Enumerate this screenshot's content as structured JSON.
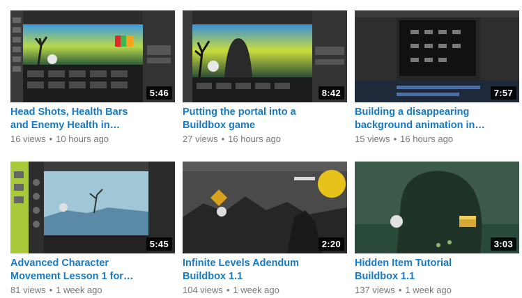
{
  "videos": [
    {
      "title_line1": "Head Shots, Health Bars",
      "title_line2": "and Enemy Health in…",
      "views": "16 views",
      "age": "10 hours ago",
      "duration": "5:46"
    },
    {
      "title_line1": "Putting the portal into a",
      "title_line2": "Buildbox game",
      "views": "27 views",
      "age": "16 hours ago",
      "duration": "8:42"
    },
    {
      "title_line1": "Building a disappearing",
      "title_line2": "background animation in…",
      "views": "15 views",
      "age": "16 hours ago",
      "duration": "7:57"
    },
    {
      "title_line1": "Advanced Character",
      "title_line2": "Movement Lesson 1 for…",
      "views": "81 views",
      "age": "1 week ago",
      "duration": "5:45"
    },
    {
      "title_line1": "Infinite Levels Adendum",
      "title_line2": "Buildbox 1.1",
      "views": "104 views",
      "age": "1 week ago",
      "duration": "2:20"
    },
    {
      "title_line1": "Hidden Item Tutorial",
      "title_line2": "Buildbox 1.1",
      "views": "137 views",
      "age": "1 week ago",
      "duration": "3:03"
    }
  ],
  "separator": "•",
  "colors": {
    "title": "#167ac6",
    "meta": "#767676",
    "duration_bg": "#000000"
  }
}
